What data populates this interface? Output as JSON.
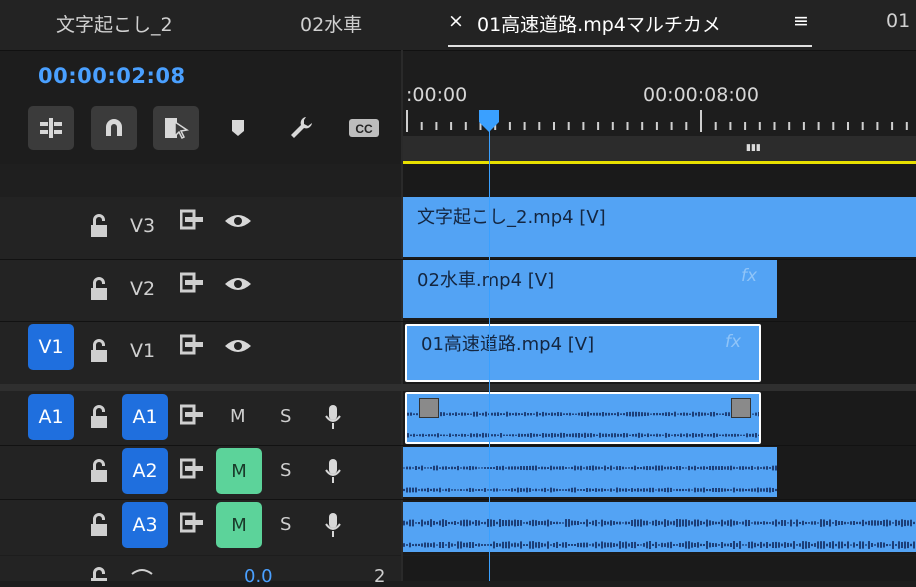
{
  "tabs": [
    {
      "label": "文字起こし_2"
    },
    {
      "label": "02水車"
    },
    {
      "label": "01高速道路.mp4マルチカメ",
      "close": "×",
      "menu": "≡"
    },
    {
      "label": "01"
    }
  ],
  "timecode": "00:00:02:08",
  "ruler": {
    "labels": [
      ":00:00",
      "00:00:08:00"
    ]
  },
  "toolbar": {
    "cc_label": "CC"
  },
  "video_tracks": [
    {
      "id": "V3",
      "label": "V3",
      "clip": {
        "name": "文字起こし_2.mp4 [V]",
        "fx": ""
      }
    },
    {
      "id": "V2",
      "label": "V2",
      "clip": {
        "name": "02水車.mp4 [V]",
        "fx": "fx"
      }
    },
    {
      "id": "V1",
      "label": "V1",
      "source": "V1",
      "clip": {
        "name": "01高速道路.mp4 [V]",
        "fx": "fx"
      }
    }
  ],
  "audio_tracks": [
    {
      "id": "A1",
      "source": "A1",
      "target": "A1",
      "m": "M",
      "s": "S"
    },
    {
      "id": "A2",
      "target": "A2",
      "m": "M",
      "s": "S"
    },
    {
      "id": "A3",
      "target": "A3",
      "m": "M",
      "s": "S"
    }
  ],
  "master": {
    "value": "0.0",
    "extra": "2"
  },
  "colors": {
    "clip": "#53a3f4",
    "accent": "#1f6fde",
    "mute_active": "#5cd39a",
    "playhead": "#3aa0ff",
    "timecode": "#4aa0ff"
  }
}
